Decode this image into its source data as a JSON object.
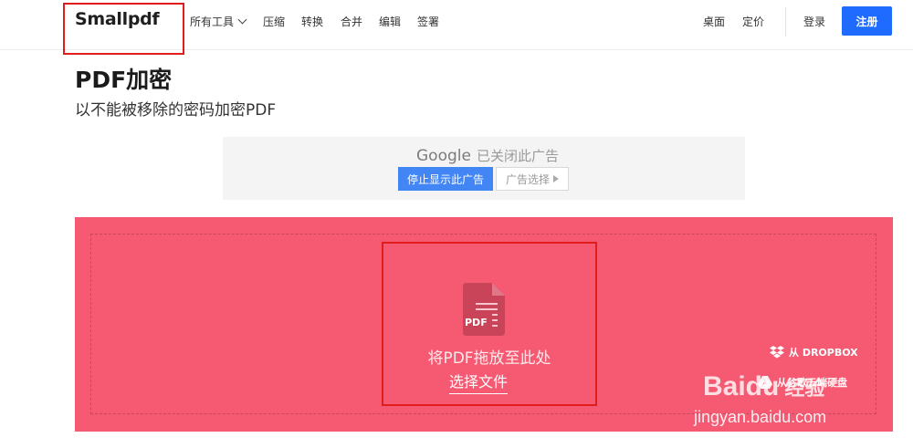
{
  "header": {
    "logo": "Smallpdf",
    "nav": [
      {
        "id": "all-tools",
        "label": "所有工具"
      },
      {
        "id": "compress",
        "label": "压缩"
      },
      {
        "id": "convert",
        "label": "转换"
      },
      {
        "id": "merge",
        "label": "合并"
      },
      {
        "id": "edit",
        "label": "编辑"
      },
      {
        "id": "sign",
        "label": "签署"
      }
    ],
    "right": {
      "desktop": "桌面",
      "pricing": "定价",
      "login": "登录",
      "signup": "注册"
    }
  },
  "page": {
    "title": "PDF加密",
    "subtitle": "以不能被移除的密码加密PDF"
  },
  "ad": {
    "brand": "Google",
    "closed": "已关闭此广告",
    "stop_label": "停止显示此广告",
    "choice_label": "广告选择"
  },
  "dropzone": {
    "pdf_badge": "PDF",
    "drag_text": "将PDF拖放至此处",
    "choose_file": "选择文件",
    "dropbox": "从 DROPBOX",
    "gdrive": "从谷歌云端硬盘"
  },
  "watermark": {
    "logo": "Baidu",
    "logo_cn": "经验",
    "url": "jingyan.baidu.com"
  },
  "colors": {
    "accent": "#1f6bff",
    "dropzone": "#f55a72",
    "ad_button": "#4285f4"
  }
}
